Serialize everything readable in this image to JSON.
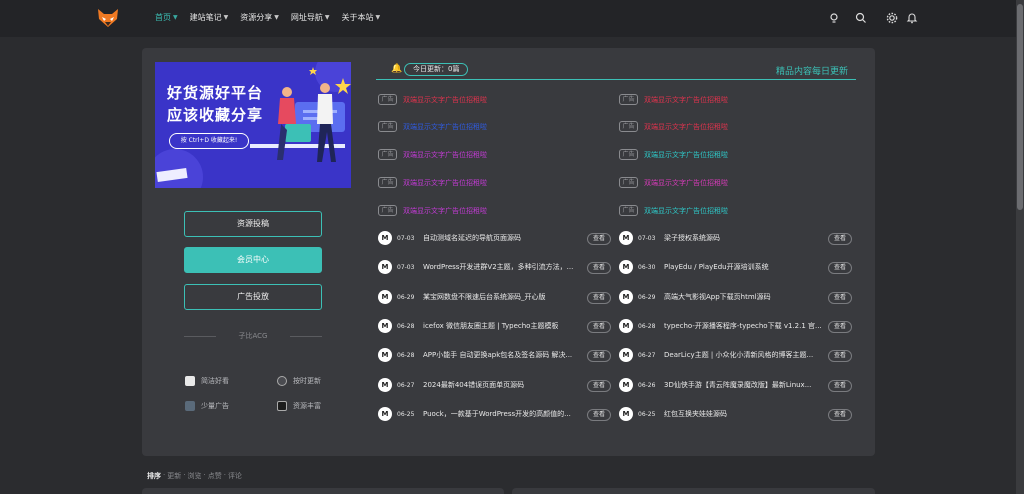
{
  "nav": {
    "items": [
      {
        "label": "首页",
        "active": true
      },
      {
        "label": "建站笔记"
      },
      {
        "label": "资源分享"
      },
      {
        "label": "网址导航"
      },
      {
        "label": "关于本站"
      }
    ],
    "header_icons": [
      "lightbulb-icon",
      "search-icon",
      "settings-icon",
      "bell-icon"
    ]
  },
  "banner": {
    "line1": "好货源好平台",
    "line2": "应该收藏分享",
    "button": "按 Ctrl+D 收藏起来!"
  },
  "sidebar": {
    "buttons": [
      "资源投稿",
      "会员中心",
      "广告投放"
    ],
    "site_name": "子比ACG",
    "features": [
      {
        "label": "简洁好看",
        "icon": "brush-icon"
      },
      {
        "label": "按时更新",
        "icon": "clock-icon"
      },
      {
        "label": "少量广告",
        "icon": "ad-icon"
      },
      {
        "label": "资源丰富",
        "icon": "box-icon"
      }
    ]
  },
  "updates": {
    "today_label": "今日更新：",
    "today_count": "0篇",
    "slogan": "精品内容每日更新"
  },
  "ads": {
    "tag": "广告",
    "items": [
      {
        "text": "双端显示文字广告位招租啦",
        "color": "#e0334d"
      },
      {
        "text": "双端显示文字广告位招租啦",
        "color": "#e0334d"
      },
      {
        "text": "双端显示文字广告位招租啦",
        "color": "#2f5be0"
      },
      {
        "text": "双端显示文字广告位招租啦",
        "color": "#e0334d"
      },
      {
        "text": "双端显示文字广告位招租啦",
        "color": "#c23bd4"
      },
      {
        "text": "双端显示文字广告位招租啦",
        "color": "#2ec8c8"
      },
      {
        "text": "双端显示文字广告位招租啦",
        "color": "#c23bd4"
      },
      {
        "text": "双端显示文字广告位招租啦",
        "color": "#d63bb8"
      },
      {
        "text": "双端显示文字广告位招租啦",
        "color": "#c23bd4"
      },
      {
        "text": "双端显示文字广告位招租啦",
        "color": "#2ec8c8"
      }
    ]
  },
  "posts": {
    "view_label": "查看",
    "avatar_letter": "M",
    "items": [
      {
        "date": "07-03",
        "title": "自动测域名延迟的导航页面源码"
      },
      {
        "date": "07-03",
        "title": "梁子授权系统源码"
      },
      {
        "date": "07-03",
        "title": "WordPress开发进群V2主题，多种引流方法，..."
      },
      {
        "date": "06-30",
        "title": "PlayEdu / PlayEdu开源培训系统"
      },
      {
        "date": "06-29",
        "title": "某宝网数盘不限速后台系统源码_开心版"
      },
      {
        "date": "06-29",
        "title": "高端大气影视App下载页html源码"
      },
      {
        "date": "06-28",
        "title": "icefox 微信朋友圈主题 | Typecho主题模板"
      },
      {
        "date": "06-28",
        "title": "typecho-开源播客程序-typecho下载 v1.2.1 官..."
      },
      {
        "date": "06-28",
        "title": "APP小能手 自动更换apk包名及签名源码 解决..."
      },
      {
        "date": "06-27",
        "title": "DearLicy主题 | 小众化小清新风格的博客主题..."
      },
      {
        "date": "06-27",
        "title": "2024最新404错误页面单页源码"
      },
      {
        "date": "06-26",
        "title": "3D仙侠手游【青云阵魔录魔改版】最新Linux..."
      },
      {
        "date": "06-25",
        "title": "Puock，一款基于WordPress开发的高颜值的..."
      },
      {
        "date": "06-25",
        "title": "红包互换夹娃娃源码"
      }
    ]
  },
  "sort_bar": {
    "items": [
      "排序",
      "更新",
      "浏览",
      "点赞",
      "评论"
    ],
    "separator": "·"
  }
}
